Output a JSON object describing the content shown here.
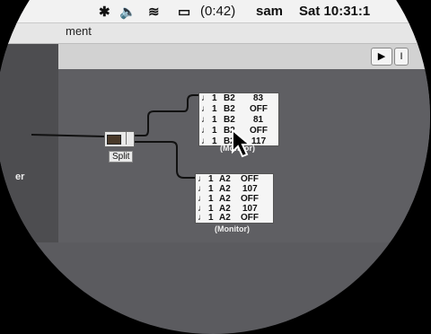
{
  "menubar": {
    "battery_time": "(0:42)",
    "user": "sam",
    "clock": "Sat 10:31:1"
  },
  "window": {
    "title_fragment": "ment"
  },
  "toolbar": {
    "pointer_glyph": "▶",
    "extra_glyph": "I"
  },
  "left_panel": {
    "label": "er"
  },
  "split": {
    "label": "Split"
  },
  "monitor_top": {
    "label": "(Monitor)",
    "rows": [
      {
        "ch": "1",
        "note": "B2",
        "val": "83"
      },
      {
        "ch": "1",
        "note": "B2",
        "val": "OFF"
      },
      {
        "ch": "1",
        "note": "B2",
        "val": "81"
      },
      {
        "ch": "1",
        "note": "B2",
        "val": "OFF"
      },
      {
        "ch": "1",
        "note": "B2",
        "val": "117"
      }
    ]
  },
  "monitor_bottom": {
    "label": "(Monitor)",
    "rows": [
      {
        "ch": "1",
        "note": "A2",
        "val": "OFF"
      },
      {
        "ch": "1",
        "note": "A2",
        "val": "107"
      },
      {
        "ch": "1",
        "note": "A2",
        "val": "OFF"
      },
      {
        "ch": "1",
        "note": "A2",
        "val": "107"
      },
      {
        "ch": "1",
        "note": "A2",
        "val": "OFF"
      }
    ]
  }
}
